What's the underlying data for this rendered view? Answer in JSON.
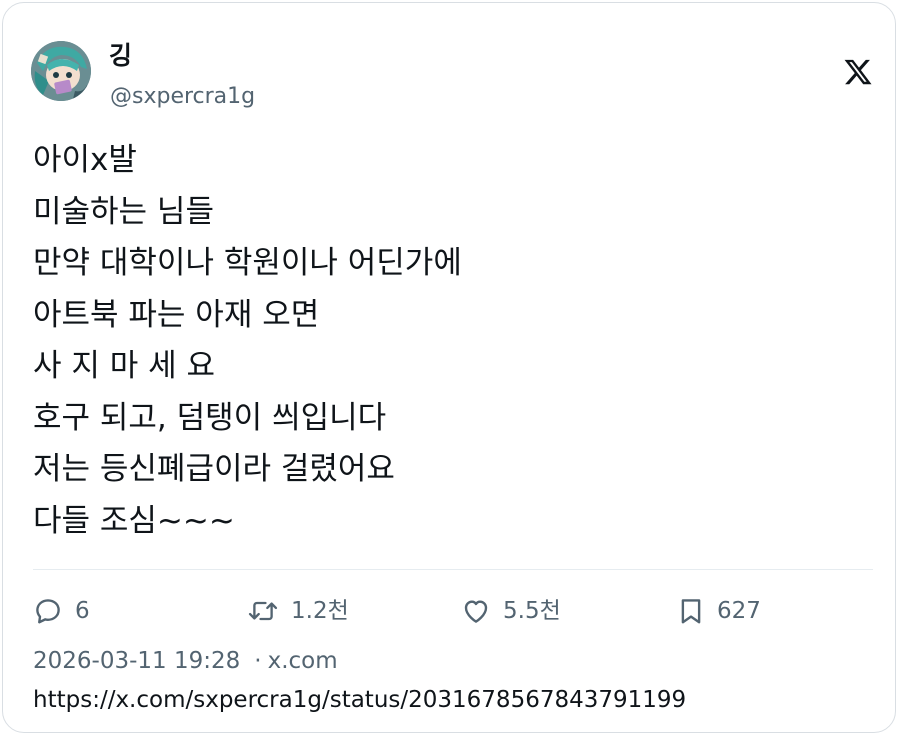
{
  "author": {
    "display_name": "깅",
    "handle": "@sxpercra1g"
  },
  "tweet": {
    "lines": [
      "아이x발",
      "미술하는 님들",
      "만약 대학이나 학원이나 어딘가에",
      "아트북 파는 아재 오면",
      "사 지 마 세 요",
      "호구 되고, 덤탱이 씌입니다",
      "저는 등신폐급이라 걸렸어요",
      "다들 조심~~~"
    ]
  },
  "actions": {
    "replies": "6",
    "retweets": "1.2천",
    "likes": "5.5천",
    "bookmarks": "627"
  },
  "meta": {
    "timestamp": "2026-03-11 19:28",
    "separator": "·",
    "source": "x.com",
    "url": "https://x.com/sxpercra1g/status/2031678567843791199"
  },
  "icons": {
    "brand": "x-logo-icon",
    "reply": "reply-icon",
    "retweet": "retweet-icon",
    "like": "heart-icon",
    "bookmark": "bookmark-icon"
  },
  "colors": {
    "text_primary": "#0f1419",
    "text_secondary": "#536471",
    "border": "#d9dee3"
  }
}
